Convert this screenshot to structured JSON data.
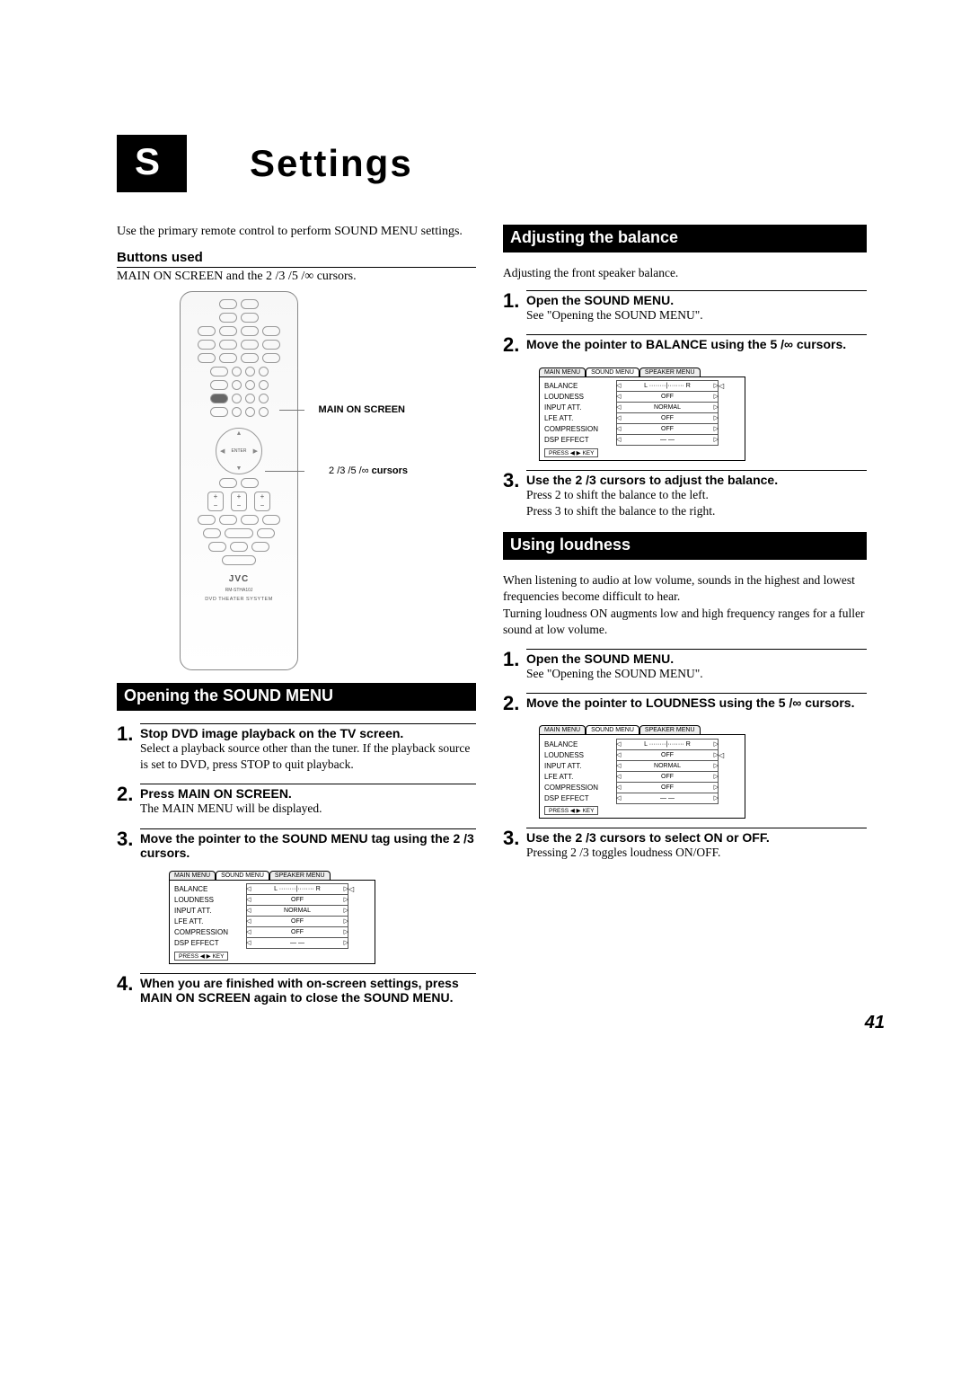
{
  "title_badge": "S",
  "title_main": "Settings",
  "intro": "Use the primary remote control to perform SOUND MENU settings.",
  "buttons_used_label": "Buttons used",
  "buttons_used_body": "MAIN ON SCREEN and the 2 /3 /5 /∞ cursors.",
  "remote_labels": {
    "main_on_screen": "MAIN ON SCREEN",
    "cursors": "2 /3 /5 /∞",
    "cursors_suffix": "cursors",
    "brand": "JVC",
    "model": "RM-STHA10J",
    "subtitle": "DVD THEATER SYSYTEM"
  },
  "sections": {
    "open_sound_menu": {
      "heading": "Opening the SOUND MENU",
      "steps": [
        {
          "title": "Stop DVD image playback on the TV screen.",
          "body": "Select a playback source other than the tuner. If the playback source is set to DVD, press STOP to quit playback."
        },
        {
          "title": "Press MAIN ON SCREEN.",
          "body": "The MAIN MENU will be displayed."
        },
        {
          "title": "Move the pointer to the SOUND MENU tag using the 2 /3 cursors.",
          "body": ""
        },
        {
          "title": "When you are finished with on-screen settings, press MAIN ON SCREEN again to close the SOUND MENU.",
          "body": ""
        }
      ]
    },
    "adjust_balance": {
      "heading": "Adjusting the balance",
      "intro": "Adjusting the front speaker balance.",
      "steps": [
        {
          "title": "Open the SOUND MENU.",
          "body": "See \"Opening the SOUND MENU\"."
        },
        {
          "title": "Move the pointer to BALANCE using the 5 /∞ cursors.",
          "body": ""
        },
        {
          "title": "Use the 2 /3 cursors to adjust the balance.",
          "body": "Press 2 to shift the balance to the left.\nPress 3 to shift the balance to the right."
        }
      ]
    },
    "using_loudness": {
      "heading": "Using loudness",
      "intro": "When listening to audio at low volume, sounds in the highest and lowest frequencies become difficult to hear.\nTurning loudness ON augments low and high frequency ranges for a fuller sound at low volume.",
      "steps": [
        {
          "title": "Open the SOUND MENU.",
          "body": "See \"Opening the SOUND MENU\"."
        },
        {
          "title": "Move the pointer to LOUDNESS using the 5 /∞ cursors.",
          "body": ""
        },
        {
          "title": "Use the 2 /3 cursors to select ON or OFF.",
          "body": "Pressing 2 /3 toggles loudness ON/OFF."
        }
      ]
    }
  },
  "menu": {
    "tabs": [
      "MAIN MENU",
      "SOUND MENU",
      "SPEAKER MENU"
    ],
    "rows": [
      {
        "key": "BALANCE",
        "val": "L ········|········ R"
      },
      {
        "key": "LOUDNESS",
        "val": "OFF"
      },
      {
        "key": "INPUT ATT.",
        "val": "NORMAL"
      },
      {
        "key": "LFE ATT.",
        "val": "OFF"
      },
      {
        "key": "COMPRESSION",
        "val": "OFF"
      },
      {
        "key": "DSP EFFECT",
        "val": "— —"
      }
    ],
    "footer": "PRESS ◀ ▶ KEY"
  },
  "page_number": "41"
}
